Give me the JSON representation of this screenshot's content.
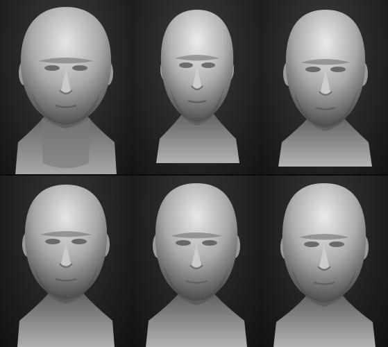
{
  "panels": [
    {
      "id": "head-1"
    },
    {
      "id": "head-2"
    },
    {
      "id": "head-3"
    },
    {
      "id": "head-4"
    },
    {
      "id": "head-5"
    },
    {
      "id": "head-6"
    }
  ],
  "colors": {
    "background": "#1a1a1a",
    "clay": "#b9b9b9",
    "clay_shadow": "#5a5a5a"
  }
}
